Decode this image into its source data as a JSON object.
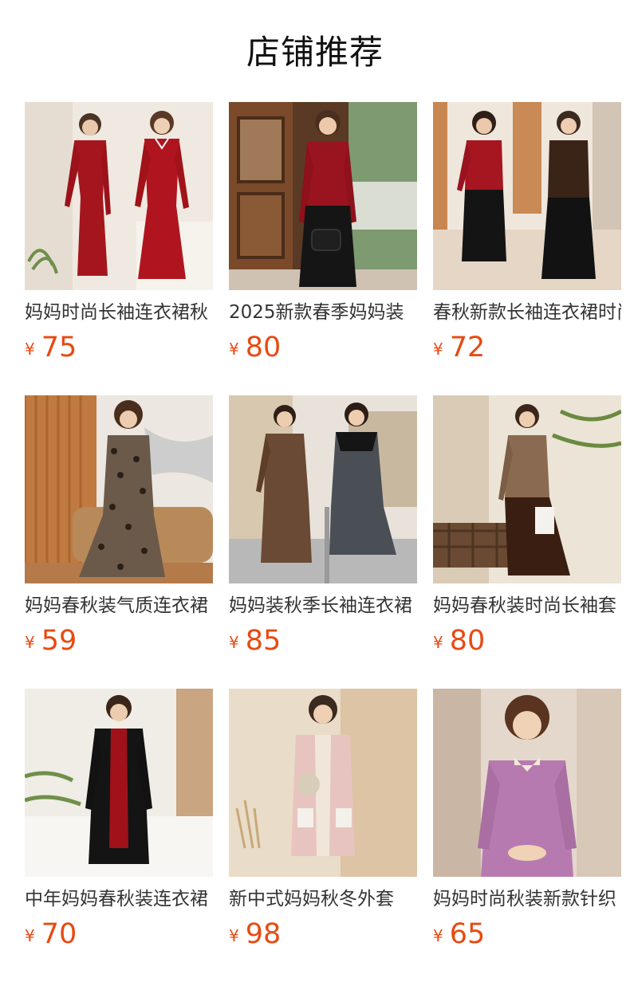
{
  "header": {
    "title": "店铺推荐"
  },
  "colors": {
    "price": "#e84a12",
    "title": "#333333"
  },
  "products": [
    {
      "title": "妈妈时尚长袖连衣裙秋",
      "currency": "¥",
      "price": "75",
      "image": "red-two-piece-dress-photo"
    },
    {
      "title": "2025新款春季妈妈装",
      "currency": "¥",
      "price": "80",
      "image": "red-cardigan-black-skirt-photo"
    },
    {
      "title": "春秋新款长袖连衣裙时尚",
      "currency": "¥",
      "price": "72",
      "image": "red-and-brown-suits-photo"
    },
    {
      "title": "妈妈春秋装气质连衣裙",
      "currency": "¥",
      "price": "59",
      "image": "leopard-print-dress-photo"
    },
    {
      "title": "妈妈装秋季长袖连衣裙",
      "currency": "¥",
      "price": "85",
      "image": "brown-and-grey-pinafore-photo"
    },
    {
      "title": "妈妈春秋装时尚长袖套",
      "currency": "¥",
      "price": "80",
      "image": "brown-tweed-jacket-photo"
    },
    {
      "title": "中年妈妈春秋装连衣裙",
      "currency": "¥",
      "price": "70",
      "image": "black-long-coat-dress-photo"
    },
    {
      "title": "新中式妈妈秋冬外套",
      "currency": "¥",
      "price": "98",
      "image": "pink-chinese-jacket-photo"
    },
    {
      "title": "妈妈时尚秋装新款针织",
      "currency": "¥",
      "price": "65",
      "image": "purple-knit-cardigan-photo"
    }
  ]
}
